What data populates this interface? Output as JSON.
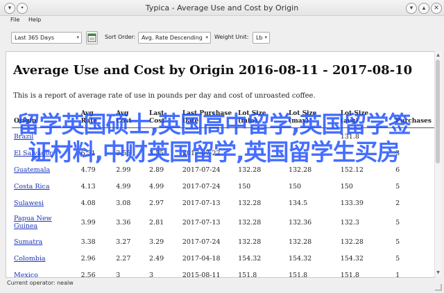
{
  "window": {
    "title": "Typica - Average Use and Cost by Origin"
  },
  "menu": [
    "File",
    "Help"
  ],
  "toolbar": {
    "date_range": "Last 365 Days",
    "sort_label": "Sort Order:",
    "sort_value": "Avg. Rate Descending",
    "weight_label": "Weight Unit:",
    "weight_value": "Lb"
  },
  "report": {
    "title": "Average Use and Cost by Origin 2016-08-11 - 2017-08-10",
    "description": "This is a report of average rate of use in pounds per day and cost of unroasted coffee.",
    "columns": [
      {
        "line1": "",
        "line2": "Origin"
      },
      {
        "line1": "Avg",
        "line2": "Rate"
      },
      {
        "line1": "Avg",
        "line2": "Cost"
      },
      {
        "line1": "Last",
        "line2": "Cost"
      },
      {
        "line1": "Last Purchase",
        "line2": "Date"
      },
      {
        "line1": "Lot Size",
        "line2": "(min)"
      },
      {
        "line1": "Lot Size",
        "line2": "(max)"
      },
      {
        "line1": "Lot Size",
        "line2": "(avg)"
      },
      {
        "line1": "",
        "line2": "Purchases"
      }
    ],
    "rows": [
      [
        "Brazil",
        "",
        "",
        "",
        "",
        "",
        "",
        "131.8",
        ""
      ],
      [
        "El Salvador",
        "6.51",
        "3.55",
        "3.55",
        "2017-07-22",
        "",
        "",
        "",
        "3"
      ],
      [
        "Guatemala",
        "4.79",
        "2.99",
        "2.89",
        "2017-07-24",
        "132.28",
        "132.28",
        "152.12",
        "6"
      ],
      [
        "Costa Rica",
        "4.13",
        "4.99",
        "4.99",
        "2017-07-24",
        "150",
        "150",
        "150",
        "5"
      ],
      [
        "Sulawesi",
        "4.08",
        "3.08",
        "2.97",
        "2017-07-13",
        "132.28",
        "134.5",
        "133.39",
        "2"
      ],
      [
        "Papua New Guinea",
        "3.99",
        "3.36",
        "2.81",
        "2017-07-13",
        "132.28",
        "132.36",
        "132.3",
        "5"
      ],
      [
        "Sumatra",
        "3.38",
        "3.27",
        "3.29",
        "2017-07-24",
        "132.28",
        "132.28",
        "132.28",
        "5"
      ],
      [
        "Colombia",
        "2.96",
        "2.27",
        "2.49",
        "2017-04-18",
        "154.32",
        "154.32",
        "154.32",
        "5"
      ],
      [
        "Mexico",
        "2.56",
        "3",
        "3",
        "2015-08-11",
        "151.8",
        "151.8",
        "151.8",
        "1"
      ]
    ]
  },
  "status": "Current operator: nealw",
  "overlay_text": "留学英国硕士,英国高中留学,英国留学签证材料,中财英国留学,英国留学生买房",
  "colors": {
    "link": "#1a33b8",
    "overlay": "#1d4fff"
  }
}
